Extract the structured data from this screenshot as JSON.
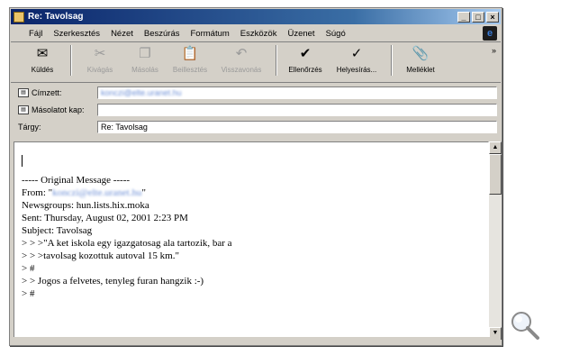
{
  "window": {
    "title": "Re: Tavolsag"
  },
  "menu": [
    "Fájl",
    "Szerkesztés",
    "Nézet",
    "Beszúrás",
    "Formátum",
    "Eszközök",
    "Üzenet",
    "Súgó"
  ],
  "toolbar": {
    "buttons": [
      {
        "label": "Küldés",
        "icon": "send-icon",
        "glyph": "✉",
        "enabled": true
      },
      {
        "label": "Kivágás",
        "icon": "cut-icon",
        "glyph": "✂",
        "enabled": false
      },
      {
        "label": "Másolás",
        "icon": "copy-icon",
        "glyph": "❐",
        "enabled": false
      },
      {
        "label": "Beillesztés",
        "icon": "paste-icon",
        "glyph": "📋",
        "enabled": false
      },
      {
        "label": "Visszavonás",
        "icon": "undo-icon",
        "glyph": "↶",
        "enabled": false
      },
      {
        "label": "Ellenőrzés",
        "icon": "check-names-icon",
        "glyph": "✔",
        "enabled": true
      },
      {
        "label": "Helyesírás...",
        "icon": "spelling-icon",
        "glyph": "✓",
        "enabled": true
      },
      {
        "label": "Melléklet",
        "icon": "attach-icon",
        "glyph": "📎",
        "enabled": true
      }
    ]
  },
  "headers": {
    "to_label": "Címzett:",
    "to_value": "konczi@elte.uranet.hu",
    "cc_label": "Másolatot kap:",
    "cc_value": "",
    "subject_label": "Tárgy:",
    "subject_value": "Re: Tavolsag"
  },
  "body": {
    "lines": [
      "----- Original Message -----",
      "From: \"konczi@elte.uranet.hu\"",
      "Newsgroups: hun.lists.hix.moka",
      "Sent: Thursday, August 02, 2001 2:23 PM",
      "Subject: Tavolsag",
      "",
      "> > >\"A ket iskola egy igazgatosag ala tartozik, bar a",
      "> > >tavolsag kozottuk autoval 15 km.\"",
      "> #",
      "> > Jogos a felvetes, tenyleg furan hangzik :-)",
      "> #"
    ]
  },
  "icons": {
    "magnifier": "magnifier-icon"
  }
}
